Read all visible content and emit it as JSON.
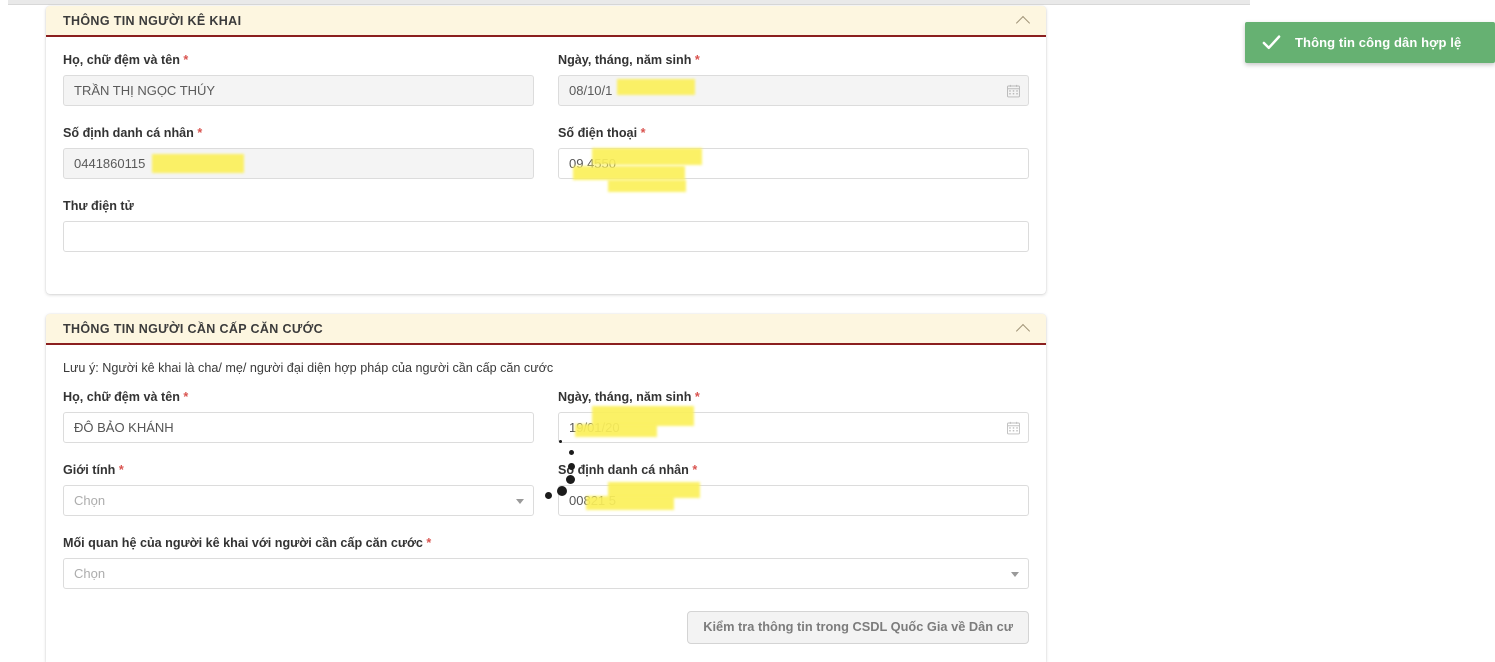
{
  "toast": {
    "icon": "check-icon",
    "message": "Thông tin công dân hợp lệ",
    "color": "#66b172"
  },
  "declarant_section": {
    "title": "THÔNG TIN NGƯỜI KÊ KHAI",
    "collapse_icon": "chevron-up-icon",
    "header_bg": "#fdf6e0",
    "header_border": "#8b1f1f",
    "fields": {
      "full_name": {
        "label": "Họ, chữ đệm và tên",
        "required": "*",
        "value": "TRẦN THỊ NGỌC THÚY",
        "readonly": true
      },
      "dob": {
        "label": "Ngày, tháng, năm sinh",
        "required": "*",
        "value": "08/10/1",
        "readonly": true,
        "icon": "calendar-icon"
      },
      "personal_id": {
        "label": "Số định danh cá nhân",
        "required": "*",
        "value": "0441860115",
        "readonly": true
      },
      "phone": {
        "label": "Số điện thoại",
        "required": "*",
        "value": "09  4550",
        "readonly": false
      },
      "email": {
        "label": "Thư điện tử",
        "required": "",
        "value": "",
        "readonly": false
      }
    }
  },
  "subject_section": {
    "title": "THÔNG TIN NGƯỜI CẦN CẤP CĂN CƯỚC",
    "collapse_icon": "chevron-up-icon",
    "note": "Lưu ý: Người kê khai là cha/ mẹ/ người đại diện hợp pháp của người cần cấp căn cước",
    "fields": {
      "full_name": {
        "label": "Họ, chữ đệm và tên",
        "required": "*",
        "value": "ĐÔ BẢO KHÁNH"
      },
      "dob": {
        "label": "Ngày, tháng, năm sinh",
        "required": "*",
        "value": "19/01/20",
        "icon": "calendar-icon"
      },
      "gender": {
        "label": "Giới tính",
        "required": "*",
        "placeholder": "Chọn",
        "value": ""
      },
      "personal_id": {
        "label": "Số định danh cá nhân",
        "required": "*",
        "value": "00821      5"
      },
      "relationship": {
        "label": "Mối quan hệ của người kê khai với người cần cấp căn cước",
        "required": "*",
        "placeholder": "Chọn",
        "value": ""
      }
    },
    "submit_button": "Kiểm tra thông tin trong CSDL Quốc Gia về Dân cư"
  }
}
